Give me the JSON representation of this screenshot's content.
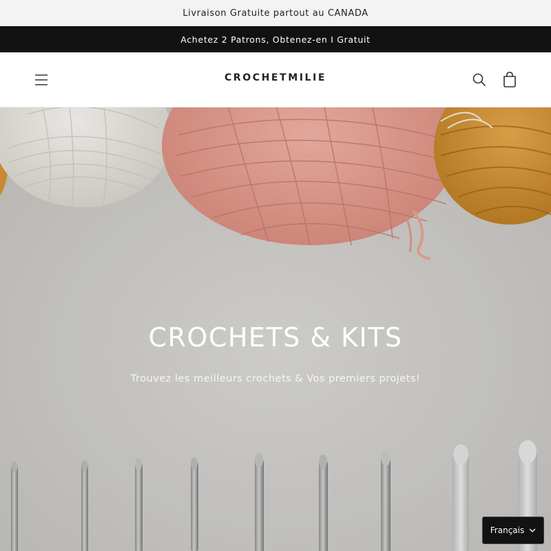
{
  "announcement": {
    "top_text": "Livraison Gratuite partout au CANADA",
    "bar_text": "Achetez 2 Patrons, Obtenez-en  I  Gratuit"
  },
  "header": {
    "logo": "CROCHETMILIE",
    "menu_icon": "hamburger-icon",
    "search_icon": "search-icon",
    "cart_icon": "cart-icon"
  },
  "hero": {
    "title": "CROCHETS & KITS",
    "subtitle": "Trouvez les meilleurs crochets & Vos premiers projets!"
  },
  "language": {
    "selected": "Français",
    "icon": "chevron-down-icon"
  },
  "colors": {
    "announcement_bg": "#f3f3f3",
    "bar_bg": "#121212",
    "hero_bg": "#d6d4d0",
    "yarn_white": "#f2efea",
    "yarn_pink": "#e8a396",
    "yarn_mustard": "#d99a3a"
  }
}
